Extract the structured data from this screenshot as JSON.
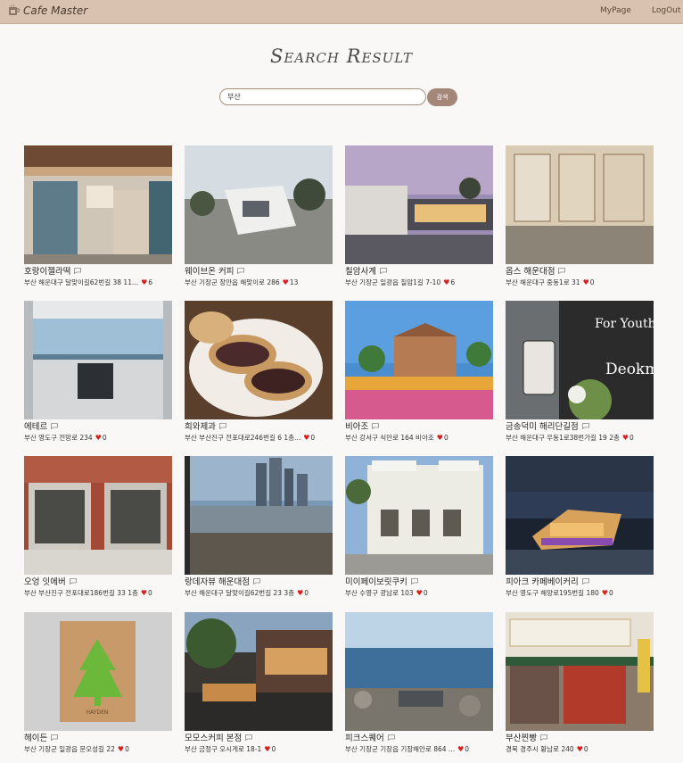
{
  "brand": {
    "name": "Cafe Master",
    "icon": "cafe-logo-icon"
  },
  "nav": {
    "mypage": "MyPage",
    "logout": "LogOut"
  },
  "page": {
    "title": "Search Result"
  },
  "search": {
    "value": "부산",
    "button": "검색"
  },
  "colors": {
    "topbar": "#d9c3b0",
    "button": "#a5877a",
    "heart": "#d81e1e",
    "background": "#faf8f6"
  },
  "cafes": [
    {
      "name": "호랑이젤라떡",
      "address": "부산 해운대구 달맞이길62번길 38 11...",
      "likes": "6",
      "image": "storefront-photo"
    },
    {
      "name": "웨이브온 커피",
      "address": "부산 기장군 장안읍 해맞이로 286",
      "likes": "13",
      "image": "modern-building-photo"
    },
    {
      "name": "칠암사계",
      "address": "부산 기장군 일광읍 칠암1길 7-10",
      "likes": "6",
      "image": "dusk-building-photo"
    },
    {
      "name": "옵스 해운대점",
      "address": "부산 해운대구 중동1로 31",
      "likes": "0",
      "image": "bakery-interior-photo"
    },
    {
      "name": "에테르",
      "address": "부산 영도구 전망로 234",
      "likes": "0",
      "image": "sea-view-interior-photo"
    },
    {
      "name": "희와제과",
      "address": "부산 부산진구 전포대로246번길 6 1층...",
      "likes": "0",
      "image": "pastry-photo"
    },
    {
      "name": "비아조",
      "address": "부산 강서구 식만로 164 비아조",
      "likes": "0",
      "image": "flower-garden-photo"
    },
    {
      "name": "금송덕미 해리단길점",
      "address": "부산 해운대구 우동1로38번가길 19 2층",
      "likes": "0",
      "image": "storefront-sign-photo"
    },
    {
      "name": "오엉 잇에버",
      "address": "부산 부산진구 전포대로186번길 33 1층",
      "likes": "0",
      "image": "brick-cafe-photo"
    },
    {
      "name": "랑데자뷰 해운대점",
      "address": "부산 해운대구 달맞이길62번길 23 3층",
      "likes": "0",
      "image": "beach-skyline-photo"
    },
    {
      "name": "미이페이보릿쿠키",
      "address": "부산 수영구 광남로 103",
      "likes": "0",
      "image": "white-building-photo"
    },
    {
      "name": "피아크 카페베이커리",
      "address": "부산 영도구 해양로195번길 180",
      "likes": "0",
      "image": "night-harbor-photo"
    },
    {
      "name": "헤이든",
      "address": "부산 기장군 일광읍 문오성길 22",
      "likes": "0",
      "image": "wood-sign-photo"
    },
    {
      "name": "모모스커피 본점",
      "address": "부산 금정구 오시게로 18-1",
      "likes": "0",
      "image": "evening-cafe-photo"
    },
    {
      "name": "피크스퀘어",
      "address": "부산 기장군 기장읍 기장해안로 864 ...",
      "likes": "0",
      "image": "rocky-coast-photo"
    },
    {
      "name": "부산찐빵",
      "address": "경북 경주시 황남로 240",
      "likes": "0",
      "image": "bun-shop-photo"
    }
  ]
}
